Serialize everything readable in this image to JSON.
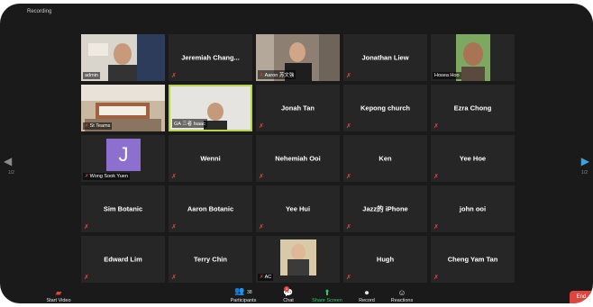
{
  "recording_label": "Recording",
  "tiles": [
    {
      "name": "admin",
      "type": "video"
    },
    {
      "name": "Jeremiah  Chang...",
      "type": "name"
    },
    {
      "name": "Aaron 苏文強",
      "type": "video"
    },
    {
      "name": "Jonathan Liew",
      "type": "name"
    },
    {
      "name": "Hosea Hoo",
      "type": "video"
    },
    {
      "name": "St Teams",
      "type": "video"
    },
    {
      "name": "GA 三者 Isaac",
      "type": "video",
      "active": true
    },
    {
      "name": "Jonah Tan",
      "type": "name"
    },
    {
      "name": "Kepong church",
      "type": "name"
    },
    {
      "name": "Ezra Chong",
      "type": "name"
    },
    {
      "name": "Wong Sook Yuen",
      "type": "avatar",
      "initial": "J"
    },
    {
      "name": "Wenni",
      "type": "name"
    },
    {
      "name": "Nehemiah Ooi",
      "type": "name"
    },
    {
      "name": "Ken",
      "type": "name"
    },
    {
      "name": "Yee Hoe",
      "type": "name"
    },
    {
      "name": "Sim Botanic",
      "type": "name"
    },
    {
      "name": "Aaron  Botanic",
      "type": "name"
    },
    {
      "name": "Yee Hui",
      "type": "name"
    },
    {
      "name": "Jazz的 iPhone",
      "type": "name"
    },
    {
      "name": "john ooi",
      "type": "name"
    },
    {
      "name": "Edward Lim",
      "type": "name"
    },
    {
      "name": "Terry Chin",
      "type": "name"
    },
    {
      "name": "AC",
      "type": "video"
    },
    {
      "name": "Hugh",
      "type": "name"
    },
    {
      "name": "Cheng Yam Tan",
      "type": "name"
    }
  ],
  "page_left": "1/2",
  "page_right": "1/2",
  "toolbar": {
    "start_video": "Start Video",
    "participants": "Participants",
    "participants_count": "38",
    "chat": "Chat",
    "chat_badge": "1",
    "share_screen": "Share Screen",
    "record": "Record",
    "reactions": "Reactions",
    "end": "End"
  },
  "colors": {
    "active_border": "#b5d44a",
    "share_green": "#2ec866",
    "muted_red": "#e0443e"
  }
}
